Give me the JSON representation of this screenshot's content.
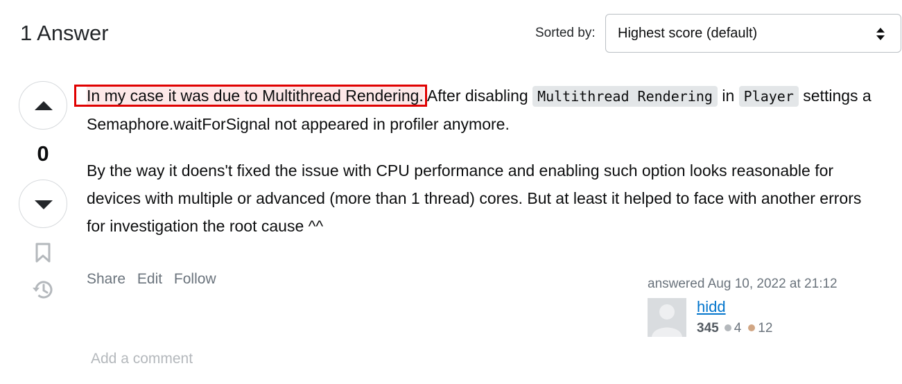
{
  "header": {
    "answers_count_title": "1 Answer",
    "sort_label": "Sorted by:",
    "sort_selected": "Highest score (default)"
  },
  "votes": {
    "score": "0",
    "up_icon": "arrow-up-icon",
    "down_icon": "arrow-down-icon",
    "bookmark_icon": "bookmark-icon",
    "history_icon": "history-icon"
  },
  "post": {
    "p1_highlighted": "In my case it was due to Multithread Rendering.",
    "p1_after_highlight": " After disabling ",
    "p1_code1": "Multithread Rendering",
    "p1_text2": " in ",
    "p1_code2": "Player",
    "p1_text3": " settings a Semaphore.waitForSignal not appeared in profiler anymore.",
    "p2": "By the way it doens't fixed the issue with CPU performance and enabling such option looks reasonable for devices with multiple or advanced (more than 1 thread) cores. But at least it helped to face with another errors for investigation the root cause ^^"
  },
  "menu": {
    "share": "Share",
    "edit": "Edit",
    "follow": "Follow"
  },
  "signature": {
    "answered": "answered Aug 10, 2022 at 21:12",
    "user_name": "hidd",
    "reputation": "345",
    "silver_badges": "4",
    "bronze_badges": "12"
  },
  "comments": {
    "add_comment": "Add a comment"
  },
  "colors": {
    "highlight_border": "#e00000",
    "link_blue": "#0074cc",
    "muted_text": "#6a737c"
  }
}
